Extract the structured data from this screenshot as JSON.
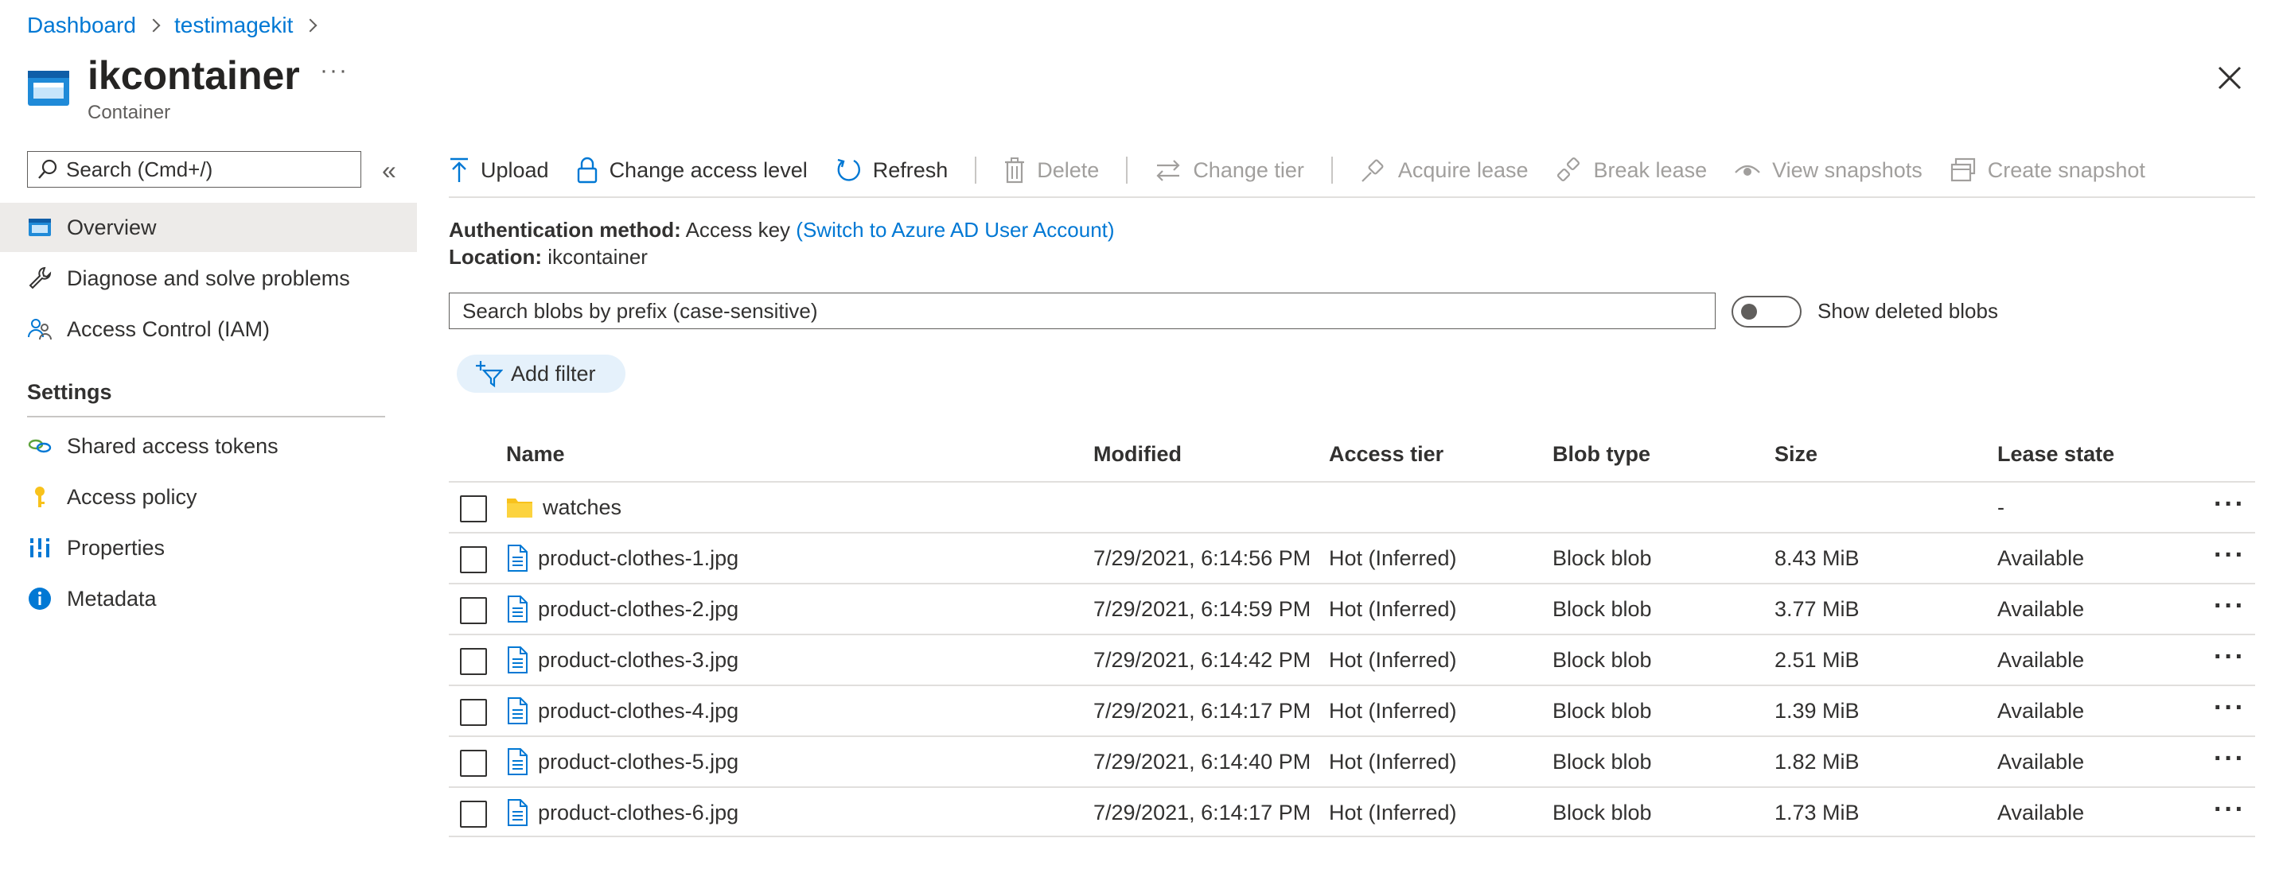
{
  "breadcrumb": {
    "items": [
      "Dashboard",
      "testimagekit"
    ]
  },
  "header": {
    "title": "ikcontainer",
    "subtitle": "Container",
    "more": "···"
  },
  "sidebar": {
    "search_placeholder": "Search (Cmd+/)",
    "collapse": "«",
    "items": [
      {
        "label": "Overview",
        "icon": "overview-icon"
      },
      {
        "label": "Diagnose and solve problems",
        "icon": "wrench-icon"
      },
      {
        "label": "Access Control (IAM)",
        "icon": "people-icon"
      }
    ],
    "settings_heading": "Settings",
    "settings_items": [
      {
        "label": "Shared access tokens",
        "icon": "link-icon"
      },
      {
        "label": "Access policy",
        "icon": "key-icon"
      },
      {
        "label": "Properties",
        "icon": "properties-icon"
      },
      {
        "label": "Metadata",
        "icon": "info-icon"
      }
    ]
  },
  "toolbar": {
    "upload": "Upload",
    "change_access": "Change access level",
    "refresh": "Refresh",
    "delete": "Delete",
    "change_tier": "Change tier",
    "acquire_lease": "Acquire lease",
    "break_lease": "Break lease",
    "view_snapshots": "View snapshots",
    "create_snapshot": "Create snapshot"
  },
  "info": {
    "auth_label": "Authentication method:",
    "auth_value": "Access key",
    "auth_link": "(Switch to Azure AD User Account)",
    "location_label": "Location:",
    "location_value": "ikcontainer"
  },
  "blob_search": {
    "placeholder": "Search blobs by prefix (case-sensitive)"
  },
  "toggle": {
    "label": "Show deleted blobs",
    "on": false
  },
  "filter": {
    "label": "Add filter"
  },
  "table": {
    "columns": [
      "Name",
      "Modified",
      "Access tier",
      "Blob type",
      "Size",
      "Lease state"
    ],
    "rows": [
      {
        "name": "watches",
        "modified": "",
        "tier": "",
        "type": "",
        "size": "",
        "lease": "-",
        "kind": "folder"
      },
      {
        "name": "product-clothes-1.jpg",
        "modified": "7/29/2021, 6:14:56 PM",
        "tier": "Hot (Inferred)",
        "type": "Block blob",
        "size": "8.43 MiB",
        "lease": "Available",
        "kind": "file"
      },
      {
        "name": "product-clothes-2.jpg",
        "modified": "7/29/2021, 6:14:59 PM",
        "tier": "Hot (Inferred)",
        "type": "Block blob",
        "size": "3.77 MiB",
        "lease": "Available",
        "kind": "file"
      },
      {
        "name": "product-clothes-3.jpg",
        "modified": "7/29/2021, 6:14:42 PM",
        "tier": "Hot (Inferred)",
        "type": "Block blob",
        "size": "2.51 MiB",
        "lease": "Available",
        "kind": "file"
      },
      {
        "name": "product-clothes-4.jpg",
        "modified": "7/29/2021, 6:14:17 PM",
        "tier": "Hot (Inferred)",
        "type": "Block blob",
        "size": "1.39 MiB",
        "lease": "Available",
        "kind": "file"
      },
      {
        "name": "product-clothes-5.jpg",
        "modified": "7/29/2021, 6:14:40 PM",
        "tier": "Hot (Inferred)",
        "type": "Block blob",
        "size": "1.82 MiB",
        "lease": "Available",
        "kind": "file"
      },
      {
        "name": "product-clothes-6.jpg",
        "modified": "7/29/2021, 6:14:17 PM",
        "tier": "Hot (Inferred)",
        "type": "Block blob",
        "size": "1.73 MiB",
        "lease": "Available",
        "kind": "file"
      }
    ],
    "row_more": "···"
  },
  "colors": {
    "accent": "#0078d4",
    "text": "#323130",
    "disabled": "#a19f9d",
    "active_bg": "#edebe9",
    "pill_bg": "#e5f1fb",
    "folder": "#f8c21c"
  }
}
